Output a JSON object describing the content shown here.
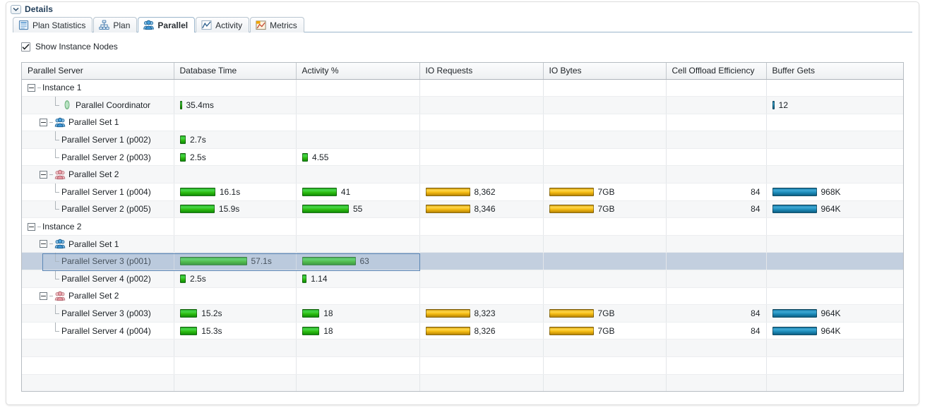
{
  "panel": {
    "title": "Details",
    "collapse_icon": "chevron-down-icon"
  },
  "tabs": [
    {
      "label": "Plan Statistics",
      "icon": "plan-statistics-icon",
      "active": false
    },
    {
      "label": "Plan",
      "icon": "plan-tree-icon",
      "active": false
    },
    {
      "label": "Parallel",
      "icon": "parallel-users-icon",
      "active": true
    },
    {
      "label": "Activity",
      "icon": "activity-chart-icon",
      "active": false
    },
    {
      "label": "Metrics",
      "icon": "metrics-chart-icon",
      "active": false
    }
  ],
  "options": {
    "show_instance_nodes_label": "Show Instance Nodes",
    "show_instance_nodes_checked": true
  },
  "colors": {
    "green": "#2fbf13",
    "gold": "#f5bd14",
    "blue": "#1f8fbd",
    "selection": "#c3cfdf",
    "focus_border": "#5b86b5"
  },
  "table": {
    "columns": [
      "Parallel Server",
      "Database Time",
      "Activity %",
      "IO Requests",
      "IO Bytes",
      "Cell Offload Efficiency",
      "Buffer Gets"
    ],
    "rows": [
      {
        "label": "Instance 1",
        "level": 0,
        "node": "instance",
        "expander": true,
        "icon": "",
        "selected": false,
        "db_time": "",
        "db_time_bar": 0,
        "activity": "",
        "activity_bar": 0,
        "io_requests": "",
        "io_requests_bar": 0,
        "io_bytes": "",
        "io_bytes_bar": 0,
        "cell_offload": "",
        "buffer_gets": "",
        "buffer_gets_bar": 0
      },
      {
        "label": "Parallel Coordinator",
        "level": 2,
        "node": "coordinator",
        "expander": false,
        "icon": "coordinator-icon",
        "selected": false,
        "db_time": "35.4ms",
        "db_time_bar": 3,
        "activity": "",
        "activity_bar": 0,
        "io_requests": "",
        "io_requests_bar": 0,
        "io_bytes": "",
        "io_bytes_bar": 0,
        "cell_offload": "",
        "buffer_gets": "12",
        "buffer_gets_bar": 3
      },
      {
        "label": "Parallel Set 1",
        "level": 1,
        "node": "set-blue",
        "expander": true,
        "icon": "parallel-set-blue-icon",
        "selected": false,
        "db_time": "",
        "db_time_bar": 0,
        "activity": "",
        "activity_bar": 0,
        "io_requests": "",
        "io_requests_bar": 0,
        "io_bytes": "",
        "io_bytes_bar": 0,
        "cell_offload": "",
        "buffer_gets": "",
        "buffer_gets_bar": 0
      },
      {
        "label": "Parallel Server 1 (p002)",
        "level": 2,
        "node": "server",
        "expander": false,
        "icon": "",
        "selected": false,
        "db_time": "2.7s",
        "db_time_bar": 9,
        "activity": "",
        "activity_bar": 0,
        "io_requests": "",
        "io_requests_bar": 0,
        "io_bytes": "",
        "io_bytes_bar": 0,
        "cell_offload": "",
        "buffer_gets": "",
        "buffer_gets_bar": 0
      },
      {
        "label": "Parallel Server 2 (p003)",
        "level": 2,
        "node": "server",
        "expander": false,
        "icon": "",
        "selected": false,
        "db_time": "2.5s",
        "db_time_bar": 9,
        "activity": "4.55",
        "activity_bar": 9,
        "io_requests": "",
        "io_requests_bar": 0,
        "io_bytes": "",
        "io_bytes_bar": 0,
        "cell_offload": "",
        "buffer_gets": "",
        "buffer_gets_bar": 0
      },
      {
        "label": "Parallel Set 2",
        "level": 1,
        "node": "set-pink",
        "expander": true,
        "icon": "parallel-set-pink-icon",
        "selected": false,
        "db_time": "",
        "db_time_bar": 0,
        "activity": "",
        "activity_bar": 0,
        "io_requests": "",
        "io_requests_bar": 0,
        "io_bytes": "",
        "io_bytes_bar": 0,
        "cell_offload": "",
        "buffer_gets": "",
        "buffer_gets_bar": 0
      },
      {
        "label": "Parallel Server 1 (p004)",
        "level": 2,
        "node": "server",
        "expander": false,
        "icon": "",
        "selected": false,
        "db_time": "16.1s",
        "db_time_bar": 53,
        "activity": "41",
        "activity_bar": 52,
        "io_requests": "8,362",
        "io_requests_bar": 60,
        "io_bytes": "7GB",
        "io_bytes_bar": 60,
        "cell_offload": "84",
        "buffer_gets": "968K",
        "buffer_gets_bar": 60
      },
      {
        "label": "Parallel Server 2 (p005)",
        "level": 2,
        "node": "server",
        "expander": false,
        "icon": "",
        "selected": false,
        "db_time": "15.9s",
        "db_time_bar": 52,
        "activity": "55",
        "activity_bar": 70,
        "io_requests": "8,346",
        "io_requests_bar": 60,
        "io_bytes": "7GB",
        "io_bytes_bar": 60,
        "cell_offload": "84",
        "buffer_gets": "964K",
        "buffer_gets_bar": 60
      },
      {
        "label": "Instance 2",
        "level": 0,
        "node": "instance",
        "expander": true,
        "icon": "",
        "selected": false,
        "db_time": "",
        "db_time_bar": 0,
        "activity": "",
        "activity_bar": 0,
        "io_requests": "",
        "io_requests_bar": 0,
        "io_bytes": "",
        "io_bytes_bar": 0,
        "cell_offload": "",
        "buffer_gets": "",
        "buffer_gets_bar": 0
      },
      {
        "label": "Parallel Set 1",
        "level": 1,
        "node": "set-blue",
        "expander": true,
        "icon": "parallel-set-blue-icon",
        "selected": false,
        "db_time": "",
        "db_time_bar": 0,
        "activity": "",
        "activity_bar": 0,
        "io_requests": "",
        "io_requests_bar": 0,
        "io_bytes": "",
        "io_bytes_bar": 0,
        "cell_offload": "",
        "buffer_gets": "",
        "buffer_gets_bar": 0
      },
      {
        "label": "Parallel Server 3 (p001)",
        "level": 2,
        "node": "server",
        "expander": false,
        "icon": "",
        "selected": true,
        "db_time": "57.1s",
        "db_time_bar": 100,
        "activity": "63",
        "activity_bar": 80,
        "io_requests": "",
        "io_requests_bar": 0,
        "io_bytes": "",
        "io_bytes_bar": 0,
        "cell_offload": "",
        "buffer_gets": "",
        "buffer_gets_bar": 0
      },
      {
        "label": "Parallel Server 4 (p002)",
        "level": 2,
        "node": "server",
        "expander": false,
        "icon": "",
        "selected": false,
        "db_time": "2.5s",
        "db_time_bar": 9,
        "activity": "1.14",
        "activity_bar": 7,
        "io_requests": "",
        "io_requests_bar": 0,
        "io_bytes": "",
        "io_bytes_bar": 0,
        "cell_offload": "",
        "buffer_gets": "",
        "buffer_gets_bar": 0
      },
      {
        "label": "Parallel Set 2",
        "level": 1,
        "node": "set-pink",
        "expander": true,
        "icon": "parallel-set-pink-icon",
        "selected": false,
        "db_time": "",
        "db_time_bar": 0,
        "activity": "",
        "activity_bar": 0,
        "io_requests": "",
        "io_requests_bar": 0,
        "io_bytes": "",
        "io_bytes_bar": 0,
        "cell_offload": "",
        "buffer_gets": "",
        "buffer_gets_bar": 0
      },
      {
        "label": "Parallel Server 3 (p003)",
        "level": 2,
        "node": "server",
        "expander": false,
        "icon": "",
        "selected": false,
        "db_time": "15.2s",
        "db_time_bar": 26,
        "activity": "18",
        "activity_bar": 26,
        "io_requests": "8,323",
        "io_requests_bar": 60,
        "io_bytes": "7GB",
        "io_bytes_bar": 60,
        "cell_offload": "84",
        "buffer_gets": "964K",
        "buffer_gets_bar": 60
      },
      {
        "label": "Parallel Server 4 (p004)",
        "level": 2,
        "node": "server",
        "expander": false,
        "icon": "",
        "selected": false,
        "db_time": "15.3s",
        "db_time_bar": 26,
        "activity": "18",
        "activity_bar": 26,
        "io_requests": "8,326",
        "io_requests_bar": 60,
        "io_bytes": "7GB",
        "io_bytes_bar": 60,
        "cell_offload": "84",
        "buffer_gets": "964K",
        "buffer_gets_bar": 60
      }
    ],
    "empty_row_count": 4
  }
}
